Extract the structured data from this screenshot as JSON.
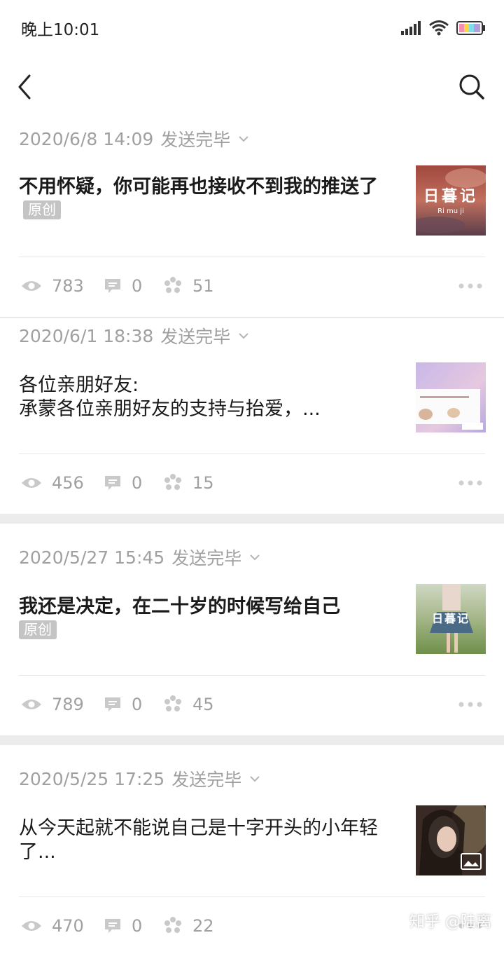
{
  "status_bar": {
    "time": "晚上10:01"
  },
  "articles": [
    {
      "date": "2020/6/8 14:09",
      "status": "发送完毕",
      "title": "不用怀疑，你可能再也接收不到我的推送了",
      "original_label": "原创",
      "thumb_title": "日暮记",
      "thumb_sub": "Ri mu ji",
      "views": "783",
      "comments": "0",
      "likes": "51"
    },
    {
      "date": "2020/6/1 18:38",
      "status": "发送完毕",
      "title_line1": "各位亲朋好友:",
      "title_line2": "承蒙各位亲朋好友的支持与抬爱，...",
      "views": "456",
      "comments": "0",
      "likes": "15"
    },
    {
      "date": "2020/5/27 15:45",
      "status": "发送完毕",
      "title": "我还是决定，在二十岁的时候写给自己",
      "original_label": "原创",
      "thumb_title": "日暮记",
      "views": "789",
      "comments": "0",
      "likes": "45"
    },
    {
      "date": "2020/5/25 17:25",
      "status": "发送完毕",
      "title": "从今天起就不能说自己是十字开头的小年轻了...",
      "views": "470",
      "comments": "0",
      "likes": "22"
    }
  ],
  "watermark": "知乎 @陆离",
  "colors": {
    "meta_gray": "#a0a0a0",
    "section_gap": "#ececec",
    "badge_bg": "#c4c4c4"
  }
}
